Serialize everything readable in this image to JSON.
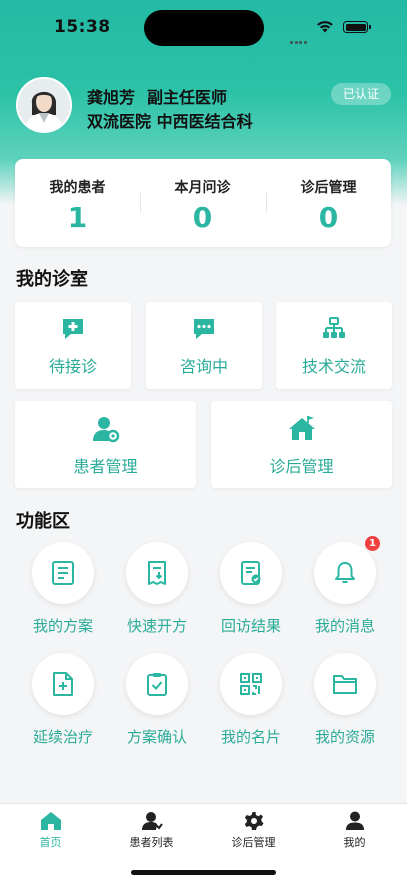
{
  "status_bar": {
    "time": "15:38"
  },
  "profile": {
    "name": "龚旭芳",
    "title": "副主任医师",
    "hospital_dept": "双流医院 中西医结合科",
    "verified_label": "已认证"
  },
  "stats": [
    {
      "label": "我的患者",
      "value": "1"
    },
    {
      "label": "本月问诊",
      "value": "0"
    },
    {
      "label": "诊后管理",
      "value": "0"
    }
  ],
  "clinic": {
    "title": "我的诊室",
    "items": [
      {
        "label": "待接诊",
        "icon": "medical-chat-icon"
      },
      {
        "label": "咨询中",
        "icon": "chat-bubble-icon"
      },
      {
        "label": "技术交流",
        "icon": "org-chart-icon"
      },
      {
        "label": "患者管理",
        "icon": "user-gear-icon"
      },
      {
        "label": "诊后管理",
        "icon": "house-flag-icon"
      }
    ]
  },
  "functions": {
    "title": "功能区",
    "items": [
      {
        "label": "我的方案",
        "icon": "document-lines-icon"
      },
      {
        "label": "快速开方",
        "icon": "prescription-download-icon"
      },
      {
        "label": "回访结果",
        "icon": "document-check-icon"
      },
      {
        "label": "我的消息",
        "icon": "bell-icon",
        "badge": "1"
      },
      {
        "label": "延续治疗",
        "icon": "document-plus-icon"
      },
      {
        "label": "方案确认",
        "icon": "clipboard-check-icon"
      },
      {
        "label": "我的名片",
        "icon": "qr-code-icon"
      },
      {
        "label": "我的资源",
        "icon": "folder-icon"
      }
    ]
  },
  "tabbar": [
    {
      "label": "首页",
      "icon": "home-icon",
      "active": true
    },
    {
      "label": "患者列表",
      "icon": "patient-icon",
      "active": false
    },
    {
      "label": "诊后管理",
      "icon": "gear-icon",
      "active": false
    },
    {
      "label": "我的",
      "icon": "person-icon",
      "active": false
    }
  ],
  "colors": {
    "accent": "#2ab6a1",
    "badge": "#f04040"
  }
}
